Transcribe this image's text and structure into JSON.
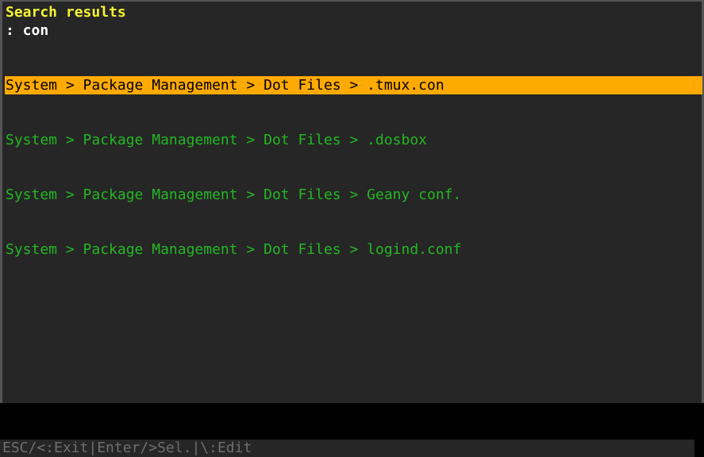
{
  "header": {
    "title": "Search results",
    "query": ": con"
  },
  "results": [
    {
      "label": "System > Package Management > Dot Files > .tmux.con",
      "selected": true
    },
    {
      "label": "System > Package Management > Dot Files > .dosbox",
      "selected": false
    },
    {
      "label": "System > Package Management > Dot Files > Geany conf.",
      "selected": false
    },
    {
      "label": "System > Package Management > Dot Files > logind.conf",
      "selected": false
    }
  ],
  "statusbar": {
    "esc": "ESC/<:Exit",
    "sep1": "|",
    "enter": "Enter/>Sel.",
    "sep2": "|",
    "edit": "\\:Edit"
  },
  "colors": {
    "title": "#f5f532",
    "result_text": "#23b723",
    "selected_bg": "#ffaa00",
    "panel_bg": "#262626"
  }
}
